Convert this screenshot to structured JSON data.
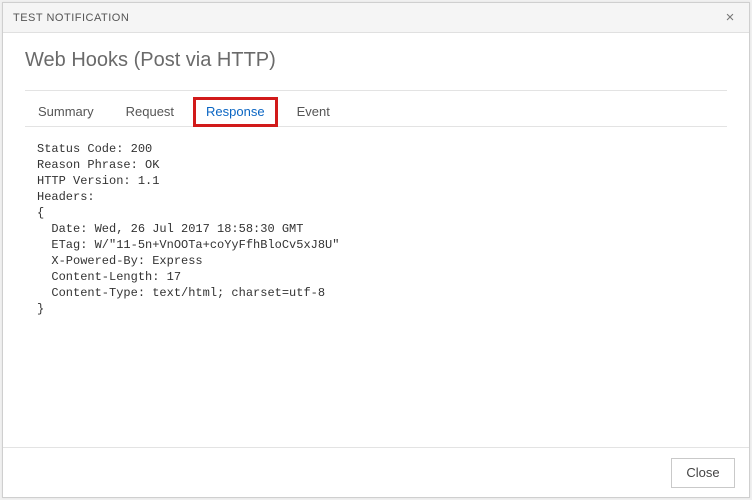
{
  "window": {
    "title": "TEST NOTIFICATION",
    "close_glyph": "×"
  },
  "heading": "Web Hooks (Post via HTTP)",
  "tabs": {
    "summary": "Summary",
    "request": "Request",
    "response": "Response",
    "event": "Event",
    "active": "response"
  },
  "response": {
    "status_code_label": "Status Code:",
    "status_code": "200",
    "reason_phrase_label": "Reason Phrase:",
    "reason_phrase": "OK",
    "http_version_label": "HTTP Version:",
    "http_version": "1.1",
    "headers_label": "Headers:",
    "headers": {
      "Date": "Wed, 26 Jul 2017 18:58:30 GMT",
      "ETag": "W/\"11-5n+VnOOTa+coYyFfhBloCv5xJ8U\"",
      "X-Powered-By": "Express",
      "Content-Length": "17",
      "Content-Type": "text/html; charset=utf-8"
    }
  },
  "footer": {
    "close_label": "Close"
  }
}
